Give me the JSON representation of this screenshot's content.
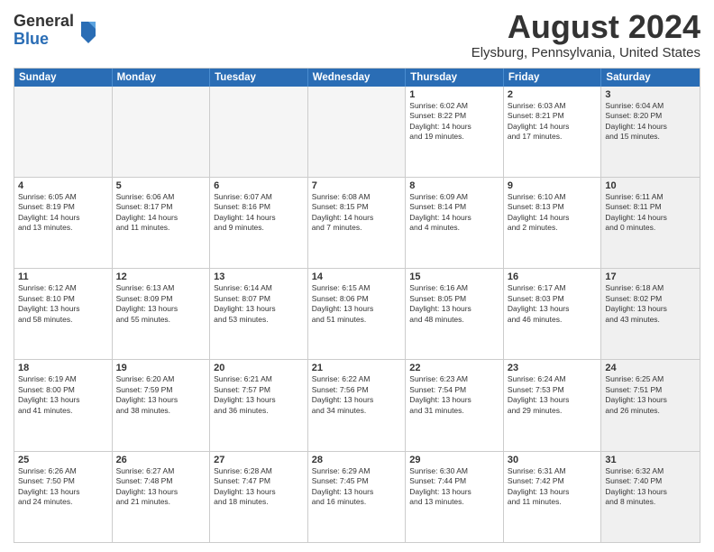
{
  "header": {
    "logo": {
      "line1": "General",
      "line2": "Blue"
    },
    "title": "August 2024",
    "subtitle": "Elysburg, Pennsylvania, United States"
  },
  "calendar": {
    "days_of_week": [
      "Sunday",
      "Monday",
      "Tuesday",
      "Wednesday",
      "Thursday",
      "Friday",
      "Saturday"
    ],
    "rows": [
      [
        {
          "day": "",
          "info": "",
          "empty": true
        },
        {
          "day": "",
          "info": "",
          "empty": true
        },
        {
          "day": "",
          "info": "",
          "empty": true
        },
        {
          "day": "",
          "info": "",
          "empty": true
        },
        {
          "day": "1",
          "info": "Sunrise: 6:02 AM\nSunset: 8:22 PM\nDaylight: 14 hours\nand 19 minutes."
        },
        {
          "day": "2",
          "info": "Sunrise: 6:03 AM\nSunset: 8:21 PM\nDaylight: 14 hours\nand 17 minutes."
        },
        {
          "day": "3",
          "info": "Sunrise: 6:04 AM\nSunset: 8:20 PM\nDaylight: 14 hours\nand 15 minutes.",
          "shaded": true
        }
      ],
      [
        {
          "day": "4",
          "info": "Sunrise: 6:05 AM\nSunset: 8:19 PM\nDaylight: 14 hours\nand 13 minutes."
        },
        {
          "day": "5",
          "info": "Sunrise: 6:06 AM\nSunset: 8:17 PM\nDaylight: 14 hours\nand 11 minutes."
        },
        {
          "day": "6",
          "info": "Sunrise: 6:07 AM\nSunset: 8:16 PM\nDaylight: 14 hours\nand 9 minutes."
        },
        {
          "day": "7",
          "info": "Sunrise: 6:08 AM\nSunset: 8:15 PM\nDaylight: 14 hours\nand 7 minutes."
        },
        {
          "day": "8",
          "info": "Sunrise: 6:09 AM\nSunset: 8:14 PM\nDaylight: 14 hours\nand 4 minutes."
        },
        {
          "day": "9",
          "info": "Sunrise: 6:10 AM\nSunset: 8:13 PM\nDaylight: 14 hours\nand 2 minutes."
        },
        {
          "day": "10",
          "info": "Sunrise: 6:11 AM\nSunset: 8:11 PM\nDaylight: 14 hours\nand 0 minutes.",
          "shaded": true
        }
      ],
      [
        {
          "day": "11",
          "info": "Sunrise: 6:12 AM\nSunset: 8:10 PM\nDaylight: 13 hours\nand 58 minutes."
        },
        {
          "day": "12",
          "info": "Sunrise: 6:13 AM\nSunset: 8:09 PM\nDaylight: 13 hours\nand 55 minutes."
        },
        {
          "day": "13",
          "info": "Sunrise: 6:14 AM\nSunset: 8:07 PM\nDaylight: 13 hours\nand 53 minutes."
        },
        {
          "day": "14",
          "info": "Sunrise: 6:15 AM\nSunset: 8:06 PM\nDaylight: 13 hours\nand 51 minutes."
        },
        {
          "day": "15",
          "info": "Sunrise: 6:16 AM\nSunset: 8:05 PM\nDaylight: 13 hours\nand 48 minutes."
        },
        {
          "day": "16",
          "info": "Sunrise: 6:17 AM\nSunset: 8:03 PM\nDaylight: 13 hours\nand 46 minutes."
        },
        {
          "day": "17",
          "info": "Sunrise: 6:18 AM\nSunset: 8:02 PM\nDaylight: 13 hours\nand 43 minutes.",
          "shaded": true
        }
      ],
      [
        {
          "day": "18",
          "info": "Sunrise: 6:19 AM\nSunset: 8:00 PM\nDaylight: 13 hours\nand 41 minutes."
        },
        {
          "day": "19",
          "info": "Sunrise: 6:20 AM\nSunset: 7:59 PM\nDaylight: 13 hours\nand 38 minutes."
        },
        {
          "day": "20",
          "info": "Sunrise: 6:21 AM\nSunset: 7:57 PM\nDaylight: 13 hours\nand 36 minutes."
        },
        {
          "day": "21",
          "info": "Sunrise: 6:22 AM\nSunset: 7:56 PM\nDaylight: 13 hours\nand 34 minutes."
        },
        {
          "day": "22",
          "info": "Sunrise: 6:23 AM\nSunset: 7:54 PM\nDaylight: 13 hours\nand 31 minutes."
        },
        {
          "day": "23",
          "info": "Sunrise: 6:24 AM\nSunset: 7:53 PM\nDaylight: 13 hours\nand 29 minutes."
        },
        {
          "day": "24",
          "info": "Sunrise: 6:25 AM\nSunset: 7:51 PM\nDaylight: 13 hours\nand 26 minutes.",
          "shaded": true
        }
      ],
      [
        {
          "day": "25",
          "info": "Sunrise: 6:26 AM\nSunset: 7:50 PM\nDaylight: 13 hours\nand 24 minutes."
        },
        {
          "day": "26",
          "info": "Sunrise: 6:27 AM\nSunset: 7:48 PM\nDaylight: 13 hours\nand 21 minutes."
        },
        {
          "day": "27",
          "info": "Sunrise: 6:28 AM\nSunset: 7:47 PM\nDaylight: 13 hours\nand 18 minutes."
        },
        {
          "day": "28",
          "info": "Sunrise: 6:29 AM\nSunset: 7:45 PM\nDaylight: 13 hours\nand 16 minutes."
        },
        {
          "day": "29",
          "info": "Sunrise: 6:30 AM\nSunset: 7:44 PM\nDaylight: 13 hours\nand 13 minutes."
        },
        {
          "day": "30",
          "info": "Sunrise: 6:31 AM\nSunset: 7:42 PM\nDaylight: 13 hours\nand 11 minutes."
        },
        {
          "day": "31",
          "info": "Sunrise: 6:32 AM\nSunset: 7:40 PM\nDaylight: 13 hours\nand 8 minutes.",
          "shaded": true
        }
      ]
    ]
  }
}
